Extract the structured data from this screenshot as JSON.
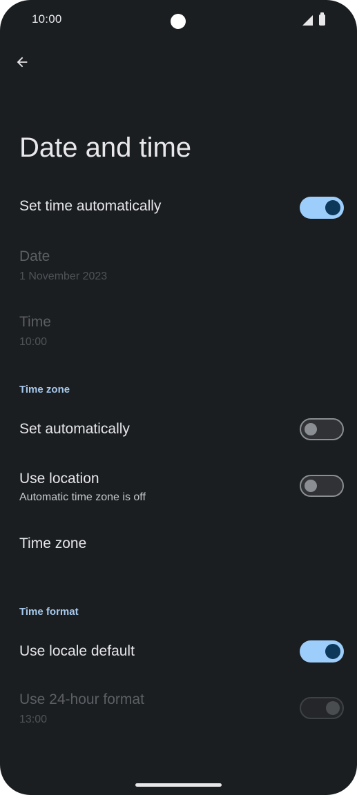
{
  "status_bar": {
    "time": "10:00",
    "icons": [
      "signal-icon",
      "battery-icon"
    ]
  },
  "toolbar": {
    "back_icon": "arrow-back-icon"
  },
  "page": {
    "title": "Date and time"
  },
  "settings": {
    "set_time_automatically": {
      "label": "Set time automatically",
      "state": "on"
    },
    "date": {
      "label": "Date",
      "value": "1 November 2023",
      "enabled": false
    },
    "time": {
      "label": "Time",
      "value": "10:00",
      "enabled": false
    },
    "time_zone_section": {
      "header": "Time zone"
    },
    "set_automatically": {
      "label": "Set automatically",
      "state": "off"
    },
    "use_location": {
      "label": "Use location",
      "summary": "Automatic time zone is off",
      "state": "off"
    },
    "time_zone": {
      "label": "Time zone"
    },
    "time_format_section": {
      "header": "Time format"
    },
    "use_locale_default": {
      "label": "Use locale default",
      "state": "on"
    },
    "use_24_hour": {
      "label": "Use 24-hour format",
      "value": "13:00",
      "enabled": false,
      "state": "on"
    }
  },
  "colors": {
    "background": "#1b1e21",
    "accent": "#9ccdfb",
    "section_header": "#a6c8ec"
  }
}
